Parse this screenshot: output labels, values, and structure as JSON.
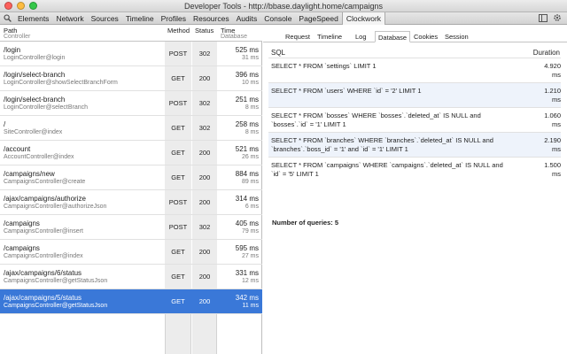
{
  "window": {
    "title": "Developer Tools - http://bbase.daylight.home/campaigns"
  },
  "toolbar": {
    "tabs": [
      "Elements",
      "Network",
      "Sources",
      "Timeline",
      "Profiles",
      "Resources",
      "Audits",
      "Console",
      "PageSpeed",
      "Clockwork"
    ],
    "active_tab": "Clockwork"
  },
  "requests": {
    "headers": {
      "path": "Path",
      "path_sub": "Controller",
      "method": "Method",
      "status": "Status",
      "time": "Time",
      "time_sub": "Database"
    },
    "rows": [
      {
        "path": "/login",
        "controller": "LoginController@login",
        "method": "POST",
        "status": "302",
        "time": "525 ms",
        "db": "31 ms"
      },
      {
        "path": "/login/select-branch",
        "controller": "LoginController@showSelectBranchForm",
        "method": "GET",
        "status": "200",
        "time": "396 ms",
        "db": "10 ms"
      },
      {
        "path": "/login/select-branch",
        "controller": "LoginController@selectBranch",
        "method": "POST",
        "status": "302",
        "time": "251 ms",
        "db": "8 ms"
      },
      {
        "path": "/",
        "controller": "SiteController@index",
        "method": "GET",
        "status": "302",
        "time": "258 ms",
        "db": "8 ms"
      },
      {
        "path": "/account",
        "controller": "AccountController@index",
        "method": "GET",
        "status": "200",
        "time": "521 ms",
        "db": "26 ms"
      },
      {
        "path": "/campaigns/new",
        "controller": "CampaignsController@create",
        "method": "GET",
        "status": "200",
        "time": "884 ms",
        "db": "89 ms"
      },
      {
        "path": "/ajax/campaigns/authorize",
        "controller": "CampaignsController@authorizeJson",
        "method": "POST",
        "status": "200",
        "time": "314 ms",
        "db": "6 ms"
      },
      {
        "path": "/campaigns",
        "controller": "CampaignsController@insert",
        "method": "POST",
        "status": "302",
        "time": "405 ms",
        "db": "79 ms"
      },
      {
        "path": "/campaigns",
        "controller": "CampaignsController@index",
        "method": "GET",
        "status": "200",
        "time": "595 ms",
        "db": "27 ms"
      },
      {
        "path": "/ajax/campaigns/6/status",
        "controller": "CampaignsController@getStatusJson",
        "method": "GET",
        "status": "200",
        "time": "331 ms",
        "db": "12 ms"
      },
      {
        "path": "/ajax/campaigns/5/status",
        "controller": "CampaignsController@getStatusJson",
        "method": "GET",
        "status": "200",
        "time": "342 ms",
        "db": "11 ms"
      }
    ],
    "selected_index": 10
  },
  "detail": {
    "tabs": [
      "Request",
      "Timeline",
      "Log",
      "Database",
      "Cookies",
      "Session"
    ],
    "active_tab": "Database",
    "sql_header": "SQL",
    "duration_header": "Duration",
    "queries": [
      {
        "sql": "SELECT * FROM `settings` LIMIT 1",
        "duration": "4.920",
        "unit": "ms"
      },
      {
        "sql": "SELECT * FROM `users` WHERE `id` = '2' LIMIT 1",
        "duration": "1.210",
        "unit": "ms"
      },
      {
        "sql": "SELECT * FROM `bosses` WHERE `bosses`.`deleted_at` IS NULL and `bosses`.`id` = '1' LIMIT 1",
        "duration": "1.060",
        "unit": "ms"
      },
      {
        "sql": "SELECT * FROM `branches` WHERE `branches`.`deleted_at` IS NULL and `branches`.`boss_id` = '1' and `id` = '1' LIMIT 1",
        "duration": "2.190",
        "unit": "ms"
      },
      {
        "sql": "SELECT * FROM `campaigns` WHERE `campaigns`.`deleted_at` IS NULL and `id` = '5' LIMIT 1",
        "duration": "1.500",
        "unit": "ms"
      }
    ],
    "query_count": "Number of queries: 5"
  },
  "icons": {
    "search": "search-icon",
    "dock": "dock-icon",
    "gear": "gear-icon"
  },
  "colors": {
    "selected_row": "#3a78d8",
    "alt_query": "#eef3fb"
  }
}
